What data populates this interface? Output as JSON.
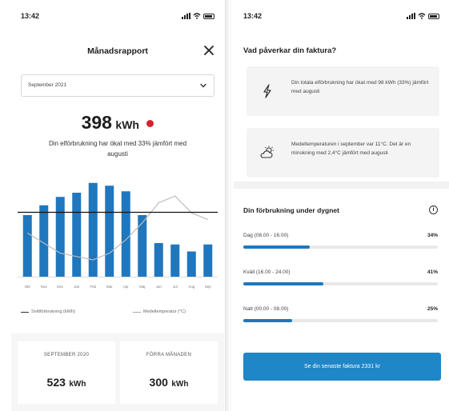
{
  "left": {
    "status_time": "13:42",
    "title": "Månadsrapport",
    "period": "September 2021",
    "total_value": "398",
    "total_unit": "kWh",
    "description": "Din elförbrukning har ökat med 33% jämfört med augusti",
    "legend_usage": "Snittförbrukning (kWh)",
    "legend_temp": "Medeltemperatur (°C)",
    "compare_left_label": "SEPTEMBER 2020",
    "compare_left_value": "523",
    "compare_left_unit": "kWh",
    "compare_right_label": "FÖRRA MÅNADEN",
    "compare_right_value": "300",
    "compare_right_unit": "kWh"
  },
  "right": {
    "status_time": "13:42",
    "heading": "Vad påverkar din faktura?",
    "card1_text": "Din totala elförbrukning har ökat med 98 kWh (33%) jämfört med augusti",
    "card2_text": "Medeltemperaturen i september var 11°C. Det är en minskning med 2,4°C jämfört med augusti",
    "subheading": "Din förbrukning under dygnet",
    "info_symbol": "i",
    "rows": [
      {
        "label": "Dag (08.00 - 16.00)",
        "percent": "34%",
        "value": 0.34
      },
      {
        "label": "Kväll (16.00 - 24.00)",
        "percent": "41%",
        "value": 0.41
      },
      {
        "label": "Natt (00.00 - 08.00)",
        "percent": "25%",
        "value": 0.25
      }
    ],
    "cta_label": "Se din senaste faktura 2331 kr"
  },
  "colors": {
    "bar": "#1f77bd",
    "accent_red": "#d2232a",
    "cta": "#1f86c7",
    "temp_line": "#bdbdbd",
    "avg_line": "#111111"
  },
  "chart_data": {
    "type": "bar",
    "categories": [
      "Okt",
      "Nov",
      "Dec",
      "Jan",
      "Feb",
      "Mar",
      "Apr",
      "Maj",
      "Jun",
      "Jul",
      "Aug",
      "Sep"
    ],
    "series": [
      {
        "name": "Snittförbrukning (kWh)",
        "values": [
          440,
          510,
          570,
          600,
          670,
          650,
          610,
          440,
          240,
          230,
          180,
          230
        ]
      },
      {
        "name": "Medeltemperatur (°C)",
        "values": [
          7,
          4,
          1,
          0,
          -1,
          1,
          5,
          10,
          16,
          18,
          13,
          11
        ]
      }
    ],
    "average_usage": 460,
    "usage_ylim": [
      0,
      720
    ],
    "temp_ylim": [
      -6,
      24
    ],
    "legend_position": "bottom",
    "grid": false
  }
}
